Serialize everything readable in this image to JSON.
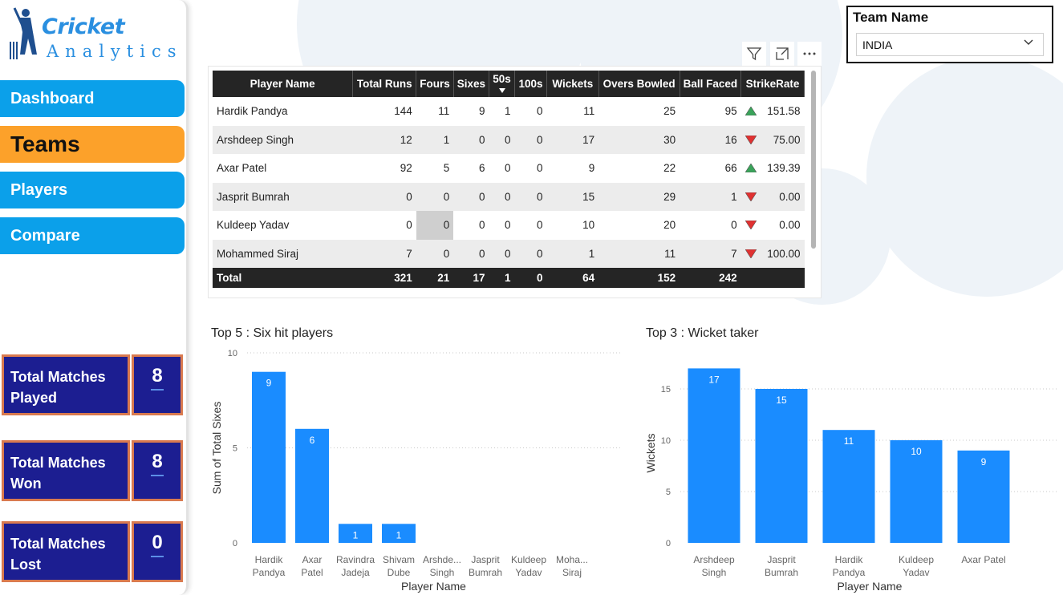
{
  "logo": {
    "word1": "Cricket",
    "word2": "Analytics"
  },
  "nav": [
    {
      "label": "Dashboard",
      "active": false
    },
    {
      "label": "Teams",
      "active": true
    },
    {
      "label": "Players",
      "active": false
    },
    {
      "label": "Compare",
      "active": false
    }
  ],
  "kpis": [
    {
      "label_line1": "Total Matches",
      "label_line2": "Played",
      "value": "8"
    },
    {
      "label_line1": "Total Matches",
      "label_line2": "Won",
      "value": "8"
    },
    {
      "label_line1": "Total Matches",
      "label_line2": "Lost",
      "value": "0"
    }
  ],
  "slicer": {
    "title": "Team Name",
    "selected": "INDIA"
  },
  "table": {
    "columns": [
      "Player Name",
      "Total Runs",
      "Fours",
      "Sixes",
      "50s",
      "100s",
      "Wickets",
      "Overs Bowled",
      "Ball Faced",
      "StrikeRate"
    ],
    "rows": [
      [
        "Hardik Pandya",
        "144",
        "11",
        "9",
        "1",
        "0",
        "11",
        "25",
        "95",
        "151.58"
      ],
      [
        "Arshdeep Singh",
        "12",
        "1",
        "0",
        "0",
        "0",
        "17",
        "30",
        "16",
        "75.00"
      ],
      [
        "Axar Patel",
        "92",
        "5",
        "6",
        "0",
        "0",
        "9",
        "22",
        "66",
        "139.39"
      ],
      [
        "Jasprit Bumrah",
        "0",
        "0",
        "0",
        "0",
        "0",
        "15",
        "29",
        "1",
        "0.00"
      ],
      [
        "Kuldeep Yadav",
        "0",
        "0",
        "0",
        "0",
        "0",
        "10",
        "20",
        "0",
        "0.00"
      ],
      [
        "Mohammed Siraj",
        "7",
        "0",
        "0",
        "0",
        "0",
        "1",
        "11",
        "7",
        "100.00"
      ]
    ],
    "trend": [
      "up",
      "down",
      "up",
      "down",
      "down",
      "down"
    ],
    "total": [
      "Total",
      "321",
      "21",
      "17",
      "1",
      "0",
      "64",
      "152",
      "242",
      ""
    ],
    "sort_column": "50s",
    "colors": {
      "up": "#3aa35a",
      "down": "#e03131"
    }
  },
  "chart_data": [
    {
      "type": "bar",
      "title": "Top 5 : Six hit players",
      "xlabel": "Player Name",
      "ylabel": "Sum of Total Sixes",
      "categories": [
        "Hardik Pandya",
        "Axar Patel",
        "Ravindra Jadeja",
        "Shivam Dube",
        "Arshde... Singh",
        "Jasprit Bumrah",
        "Kuldeep Yadav",
        "Moha... Siraj"
      ],
      "category_lines": [
        [
          "Hardik",
          "Pandya"
        ],
        [
          "Axar",
          "Patel"
        ],
        [
          "Ravindra",
          "Jadeja"
        ],
        [
          "Shivam",
          "Dube"
        ],
        [
          "Arshde...",
          "Singh"
        ],
        [
          "Jasprit",
          "Bumrah"
        ],
        [
          "Kuldeep",
          "Yadav"
        ],
        [
          "Moha...",
          "Siraj"
        ]
      ],
      "values": [
        9,
        6,
        1,
        1,
        0,
        0,
        0,
        0
      ],
      "data_labels": [
        "9",
        "6",
        "1",
        "1",
        "",
        "",
        "",
        ""
      ],
      "yticks": [
        0,
        5,
        10
      ],
      "ylim": [
        0,
        10
      ],
      "grid": true,
      "color": "#1a8cff"
    },
    {
      "type": "bar",
      "title": "Top 3 : Wicket taker",
      "xlabel": "Player Name",
      "ylabel": "Wickets",
      "categories": [
        "Arshdeep Singh",
        "Jasprit Bumrah",
        "Hardik Pandya",
        "Kuldeep Yadav",
        "Axar Patel"
      ],
      "category_lines": [
        [
          "Arshdeep",
          "Singh"
        ],
        [
          "Jasprit",
          "Bumrah"
        ],
        [
          "Hardik",
          "Pandya"
        ],
        [
          "Kuldeep",
          "Yadav"
        ],
        [
          "Axar Patel"
        ]
      ],
      "values": [
        17,
        15,
        11,
        10,
        9
      ],
      "data_labels": [
        "17",
        "15",
        "11",
        "10",
        "9"
      ],
      "yticks": [
        0,
        5,
        10,
        15
      ],
      "ylim": [
        0,
        17.5
      ],
      "grid": true,
      "color": "#1a8cff"
    }
  ]
}
